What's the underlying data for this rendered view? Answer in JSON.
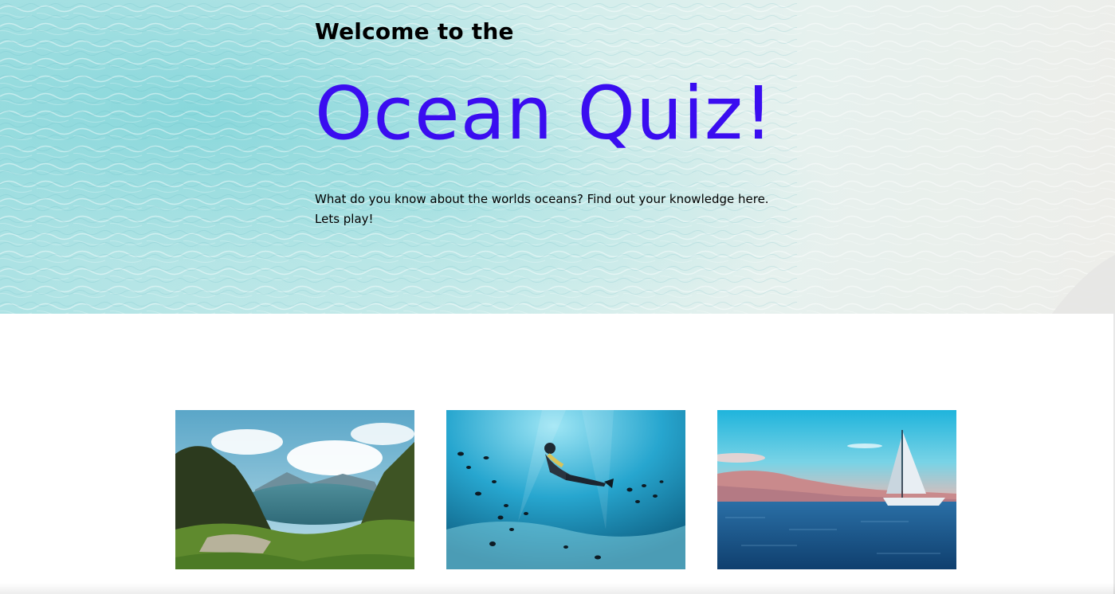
{
  "hero": {
    "welcome": "Welcome to the",
    "title": "Ocean Quiz!",
    "intro_line1": "What do you know about the worlds oceans? Find out your knowledge here.",
    "intro_line2": "Lets play!",
    "title_color": "#3a0df0"
  },
  "gallery": {
    "images": [
      {
        "subject": "crater-lake-mountains"
      },
      {
        "subject": "diver-with-fish"
      },
      {
        "subject": "sailboat-at-sea"
      }
    ]
  }
}
